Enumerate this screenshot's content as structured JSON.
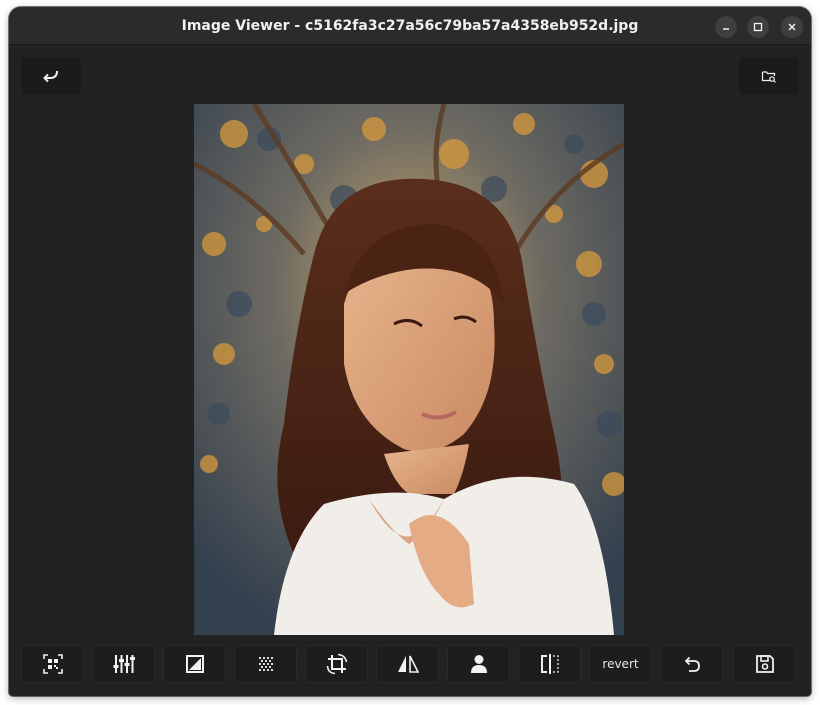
{
  "window": {
    "title": "Image Viewer - c5162fa3c27a56c79ba57a4358eb952d.jpg",
    "controls": [
      "minimize-icon",
      "maximize-icon",
      "close-icon"
    ]
  },
  "top_bar": {
    "back_icon": "return-arrow-icon",
    "open_folder_icon": "folder-search-icon"
  },
  "image": {
    "subject": "photo"
  },
  "toolbar": {
    "buttons": [
      {
        "icon": "qr-code-icon"
      },
      {
        "icon": "adjust-sliders-icon"
      },
      {
        "icon": "contrast-icon"
      },
      {
        "icon": "dither-grid-icon"
      },
      {
        "icon": "crop-rotate-icon"
      },
      {
        "icon": "flip-horizontal-icon"
      },
      {
        "icon": "person-icon"
      },
      {
        "icon": "split-view-icon"
      },
      {
        "label": "revert"
      },
      {
        "icon": "undo-icon"
      },
      {
        "icon": "save-icon"
      }
    ]
  },
  "colors": {
    "window_bg": "#222222",
    "titlebar_bg": "#2b2b2b",
    "button_bg": "#1d1d1d",
    "icon": "#f2f2f2"
  }
}
